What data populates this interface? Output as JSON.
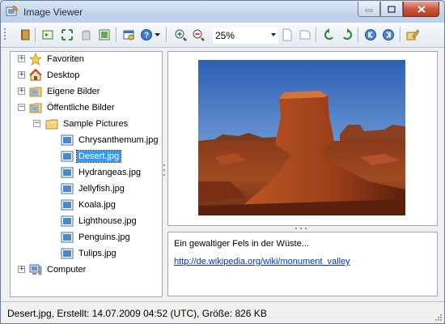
{
  "window": {
    "title": "Image Viewer"
  },
  "toolbar": {
    "zoom_value": "25%",
    "icons": [
      "bookmark-icon",
      "open-folder-icon",
      "fullscreen-icon",
      "copy-icon",
      "image-icon",
      "properties-icon",
      "help-icon",
      "zoom-in-icon",
      "zoom-out-icon",
      "page-icon",
      "page-fit-icon",
      "rotate-left-icon",
      "rotate-right-icon",
      "previous-icon",
      "next-icon",
      "edit-icon"
    ]
  },
  "tree": {
    "items": [
      {
        "label": "Favoriten",
        "icon": "star-icon"
      },
      {
        "label": "Desktop",
        "icon": "home-icon"
      },
      {
        "label": "Eigene Bilder",
        "icon": "pictures-folder-icon"
      },
      {
        "label": "Öffentliche Bilder",
        "icon": "pictures-folder-icon"
      },
      {
        "label": "Sample Pictures",
        "icon": "folder-icon"
      },
      {
        "label": "Chrysanthemum.jpg",
        "icon": "image-file-icon"
      },
      {
        "label": "Desert.jpg",
        "icon": "image-file-icon",
        "selected": true
      },
      {
        "label": "Hydrangeas.jpg",
        "icon": "image-file-icon"
      },
      {
        "label": "Jellyfish.jpg",
        "icon": "image-file-icon"
      },
      {
        "label": "Koala.jpg",
        "icon": "image-file-icon"
      },
      {
        "label": "Lighthouse.jpg",
        "icon": "image-file-icon"
      },
      {
        "label": "Penguins.jpg",
        "icon": "image-file-icon"
      },
      {
        "label": "Tulips.jpg",
        "icon": "image-file-icon"
      },
      {
        "label": "Computer",
        "icon": "computer-icon"
      }
    ]
  },
  "description": {
    "text": "Ein gewaltiger Fels in der Wüste...",
    "link": "http://de.wikipedia.org/wiki/monument_valley"
  },
  "status": {
    "text": "Desert.jpg, Erstellt: 14.07.2009 04:52 (UTC), Größe: 826 KB"
  },
  "colors": {
    "selection": "#3399ff",
    "link": "#0033cc",
    "sky": "#4a7fc8",
    "rock": "#a0401c"
  }
}
